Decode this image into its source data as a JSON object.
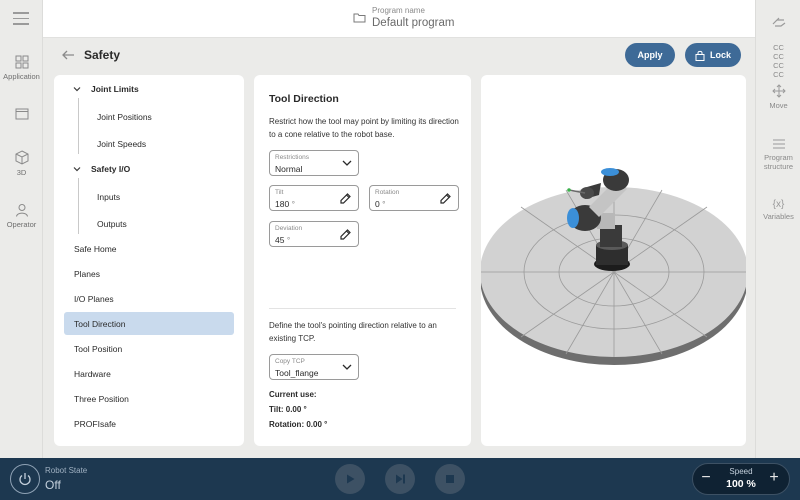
{
  "header": {
    "program_label": "Program name",
    "program_name": "Default program"
  },
  "left_nav": {
    "items": [
      {
        "label": "Application",
        "icon": "grid-icon"
      },
      {
        "label": "",
        "icon": "window-icon"
      },
      {
        "label": "3D",
        "icon": "cube-icon"
      },
      {
        "label": "Operator",
        "icon": "person-icon"
      }
    ]
  },
  "right_nav": {
    "items": [
      {
        "label": "",
        "icon": "hand-icon"
      },
      {
        "label": "CC CC CC CC",
        "icon": ""
      },
      {
        "label": "Move",
        "icon": "move-arrows-icon"
      },
      {
        "label": "Program structure",
        "icon": "list-icon"
      },
      {
        "label": "Variables",
        "icon": "braces-icon"
      }
    ]
  },
  "page": {
    "title": "Safety",
    "apply_label": "Apply",
    "lock_label": "Lock"
  },
  "safety_nav": {
    "joint_limits": "Joint Limits",
    "joint_positions": "Joint Positions",
    "joint_speeds": "Joint Speeds",
    "safety_io": "Safety I/O",
    "inputs": "Inputs",
    "outputs": "Outputs",
    "safe_home": "Safe Home",
    "planes": "Planes",
    "io_planes": "I/O Planes",
    "tool_direction": "Tool Direction",
    "tool_position": "Tool Position",
    "hardware": "Hardware",
    "three_position": "Three Position",
    "profisafe": "PROFIsafe",
    "selected": "Tool Direction"
  },
  "form": {
    "title": "Tool Direction",
    "description": "Restrict how the tool may point by limiting its direction to a cone relative to the robot base.",
    "restrictions": {
      "label": "Restrictions",
      "value": "Normal"
    },
    "tilt": {
      "label": "Tilt",
      "value": "180",
      "unit": "°"
    },
    "rotation": {
      "label": "Rotation",
      "value": "0",
      "unit": "°"
    },
    "deviation": {
      "label": "Deviation",
      "value": "45",
      "unit": "°"
    },
    "description2": "Define the tool's pointing direction relative to an existing TCP.",
    "copy_tcp": {
      "label": "Copy TCP",
      "value": "Tool_flange"
    },
    "current_use": "Current use:",
    "current_tilt": "Tilt: 0.00 °",
    "current_rotation": "Rotation: 0.00 °"
  },
  "bottom": {
    "robot_state_label": "Robot State",
    "robot_state_value": "Off",
    "speed_label": "Speed",
    "speed_value": "100 %",
    "minus": "−",
    "plus": "+"
  },
  "colors": {
    "accent": "#3e6a97",
    "bottom_bar": "#1d3850",
    "selected_bg": "#c9daed"
  }
}
